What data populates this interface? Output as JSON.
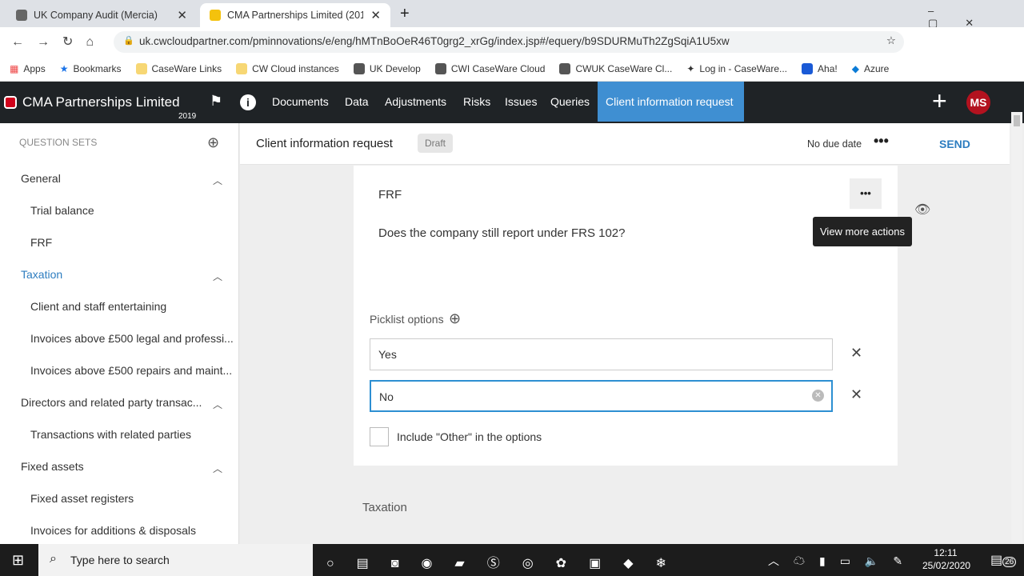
{
  "browser": {
    "tabs": [
      {
        "title": "UK Company Audit (Mercia)"
      },
      {
        "title": "CMA Partnerships Limited (2019)"
      }
    ],
    "url": "uk.cwcloudpartner.com/pminnovations/e/eng/hMTnBoOeR46T0grg2_xrGg/index.jsp#/equery/b9SDURMuTh2ZgSqiA1U5xw",
    "bookmarks": [
      "Apps",
      "Bookmarks",
      "CaseWare Links",
      "CW Cloud instances",
      "UK Develop",
      "CWI CaseWare Cloud",
      "CWUK CaseWare Cl...",
      "Log in - CaseWare...",
      "Aha!",
      "Azure"
    ]
  },
  "app": {
    "entity": "CMA Partnerships Limited",
    "year": "2019",
    "nav": [
      "Documents",
      "Data",
      "Adjustments",
      "Risks",
      "Issues",
      "Queries",
      "Client information request"
    ],
    "user_initials": "MS",
    "accent": "#3f8fd2"
  },
  "sidebar": {
    "heading": "QUESTION SETS",
    "items": [
      {
        "label": "General",
        "group": true
      },
      {
        "label": "Trial balance"
      },
      {
        "label": "FRF"
      },
      {
        "label": "Taxation",
        "group": true,
        "active": true
      },
      {
        "label": "Client and staff entertaining"
      },
      {
        "label": "Invoices above £500 legal and professi..."
      },
      {
        "label": "Invoices above £500 repairs and maint..."
      },
      {
        "label": "Directors and related party transac...",
        "group": true
      },
      {
        "label": "Transactions with related parties"
      },
      {
        "label": "Fixed assets",
        "group": true
      },
      {
        "label": "Fixed asset registers"
      },
      {
        "label": "Invoices for additions & disposals"
      }
    ]
  },
  "header": {
    "title": "Client information request",
    "status": "Draft",
    "due": "No due date",
    "send": "SEND"
  },
  "card": {
    "section": "FRF",
    "question": "Does the company still report under FRS 102?",
    "tooltip": "View more actions",
    "picklist_label": "Picklist options",
    "options": [
      "Yes",
      "No"
    ],
    "include_other": "Include \"Other\" in the options"
  },
  "next_section": "Taxation",
  "taskbar": {
    "search": "Type here to search",
    "time": "12:11",
    "date": "25/02/2020",
    "notifications": "26"
  }
}
